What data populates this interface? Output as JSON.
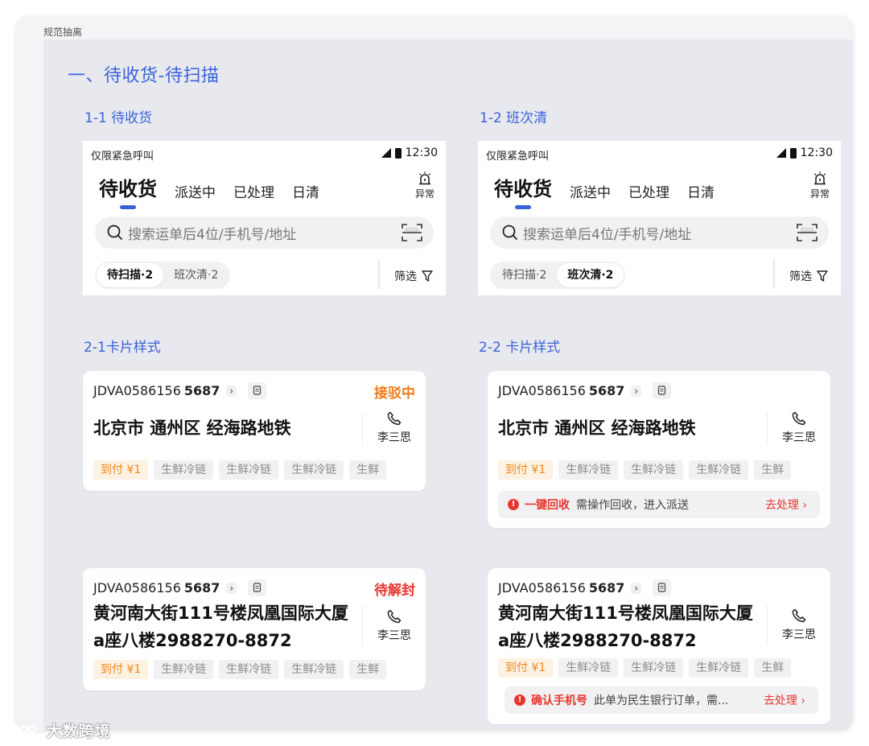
{
  "frame_label": "规范抽离",
  "section_title": "一、待收货-待扫描",
  "subsections": {
    "s11": "1-1 待收货",
    "s12": "1-2 班次清",
    "s21": "2-1卡片样式",
    "s22": "2-2 卡片样式"
  },
  "phone": {
    "status_left": "仅限紧急呼叫",
    "time": "12:30",
    "tabs": [
      "待收货",
      "派送中",
      "已处理",
      "日清"
    ],
    "alarm_label": "异常",
    "search_placeholder": "搜索运单后4位/手机号/地址",
    "segments": [
      "待扫描·2",
      "班次清·2"
    ],
    "filter_label": "筛选"
  },
  "cards": [
    {
      "waybill_prefix": "JDVA0586156",
      "waybill_suffix": "5687",
      "status": "接驳中",
      "status_color": "#f07a1a",
      "address_l1": "北京市 通州区 经海路地铁",
      "address_l2": "",
      "contact": "李三思",
      "tags": [
        "到付 ¥1",
        "生鲜冷链",
        "生鲜冷链",
        "生鲜冷链",
        "生鲜"
      ]
    },
    {
      "waybill_prefix": "JDVA0586156",
      "waybill_suffix": "5687",
      "status": "",
      "address_l1": "北京市 通州区 经海路地铁",
      "address_l2": "",
      "contact": "李三思",
      "tags": [
        "到付 ¥1",
        "生鲜冷链",
        "生鲜冷链",
        "生鲜冷链",
        "生鲜"
      ],
      "notice": {
        "title": "一键回收",
        "text": "需操作回收，进入派送",
        "action": "去处理"
      }
    },
    {
      "waybill_prefix": "JDVA0586156",
      "waybill_suffix": "5687",
      "status": "待解封",
      "status_color": "#e8362d",
      "address_l1": "黄河南大街111号楼凤凰国际大厦",
      "address_l2": "a座八楼2988270-8872",
      "contact": "李三思",
      "tags": [
        "到付 ¥1",
        "生鲜冷链",
        "生鲜冷链",
        "生鲜冷链",
        "生鲜"
      ]
    },
    {
      "waybill_prefix": "JDVA0586156",
      "waybill_suffix": "5687",
      "status": "",
      "address_l1": "黄河南大街111号楼凤凰国际大厦",
      "address_l2": "a座八楼2988270-8872",
      "contact": "李三思",
      "tags": [
        "到付 ¥1",
        "生鲜冷链",
        "生鲜冷链",
        "生鲜冷链",
        "生鲜"
      ],
      "notice": {
        "title": "确认手机号",
        "text": "此单为民生银行订单，需...",
        "action": "去处理"
      }
    }
  ],
  "watermark": "大数跨境",
  "icons": {
    "signal": "signal-icon",
    "battery": "battery-icon",
    "alarm": "alarm-icon",
    "search": "search-icon",
    "scan": "scan-icon",
    "filter": "filter-icon",
    "phone": "phone-icon",
    "copy": "copy-icon",
    "chevron": "chevron-right-icon",
    "alert": "alert-icon"
  },
  "colors": {
    "accent": "#3a62d8",
    "orange": "#f07a1a",
    "red": "#e8362d",
    "pay_tag_bg": "#fdf1e2",
    "canvas_bg": "#e8e9ee"
  }
}
